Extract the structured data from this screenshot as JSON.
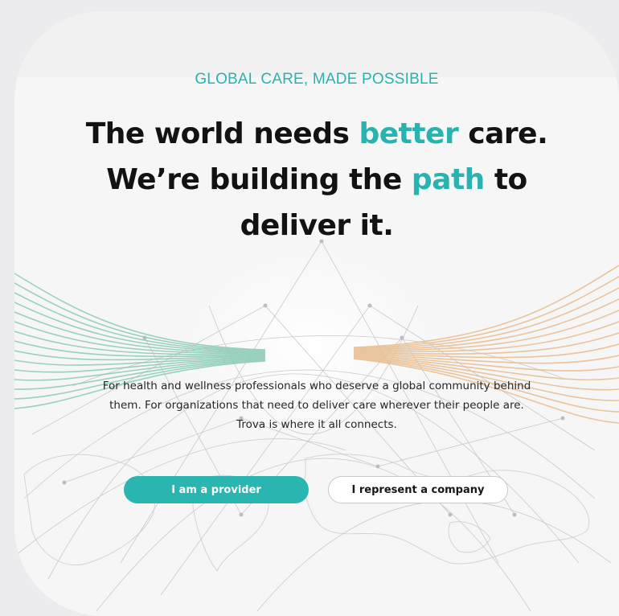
{
  "hero": {
    "eyebrow": "GLOBAL CARE, MADE POSSIBLE",
    "headline": {
      "line1_pre": "The world needs ",
      "line1_accent": "better",
      "line1_post": " care.",
      "line2_pre": "We’re building the ",
      "line2_accent": "path",
      "line2_post": " to",
      "line3": "deliver it."
    },
    "description": "For health and wellness professionals who deserve a global community behind them. For organizations that need to deliver care wherever their people are. Trova is where it all connects."
  },
  "actions": {
    "provider_label": "I am a provider",
    "company_label": "I represent a company"
  },
  "colors": {
    "accent": "#27b3b0",
    "button_primary": "#2ab5b1",
    "left_wave": "#8fcdb8",
    "right_wave": "#e8bf93",
    "page_background": "#ececee",
    "card_background": "#f6f6f6"
  }
}
